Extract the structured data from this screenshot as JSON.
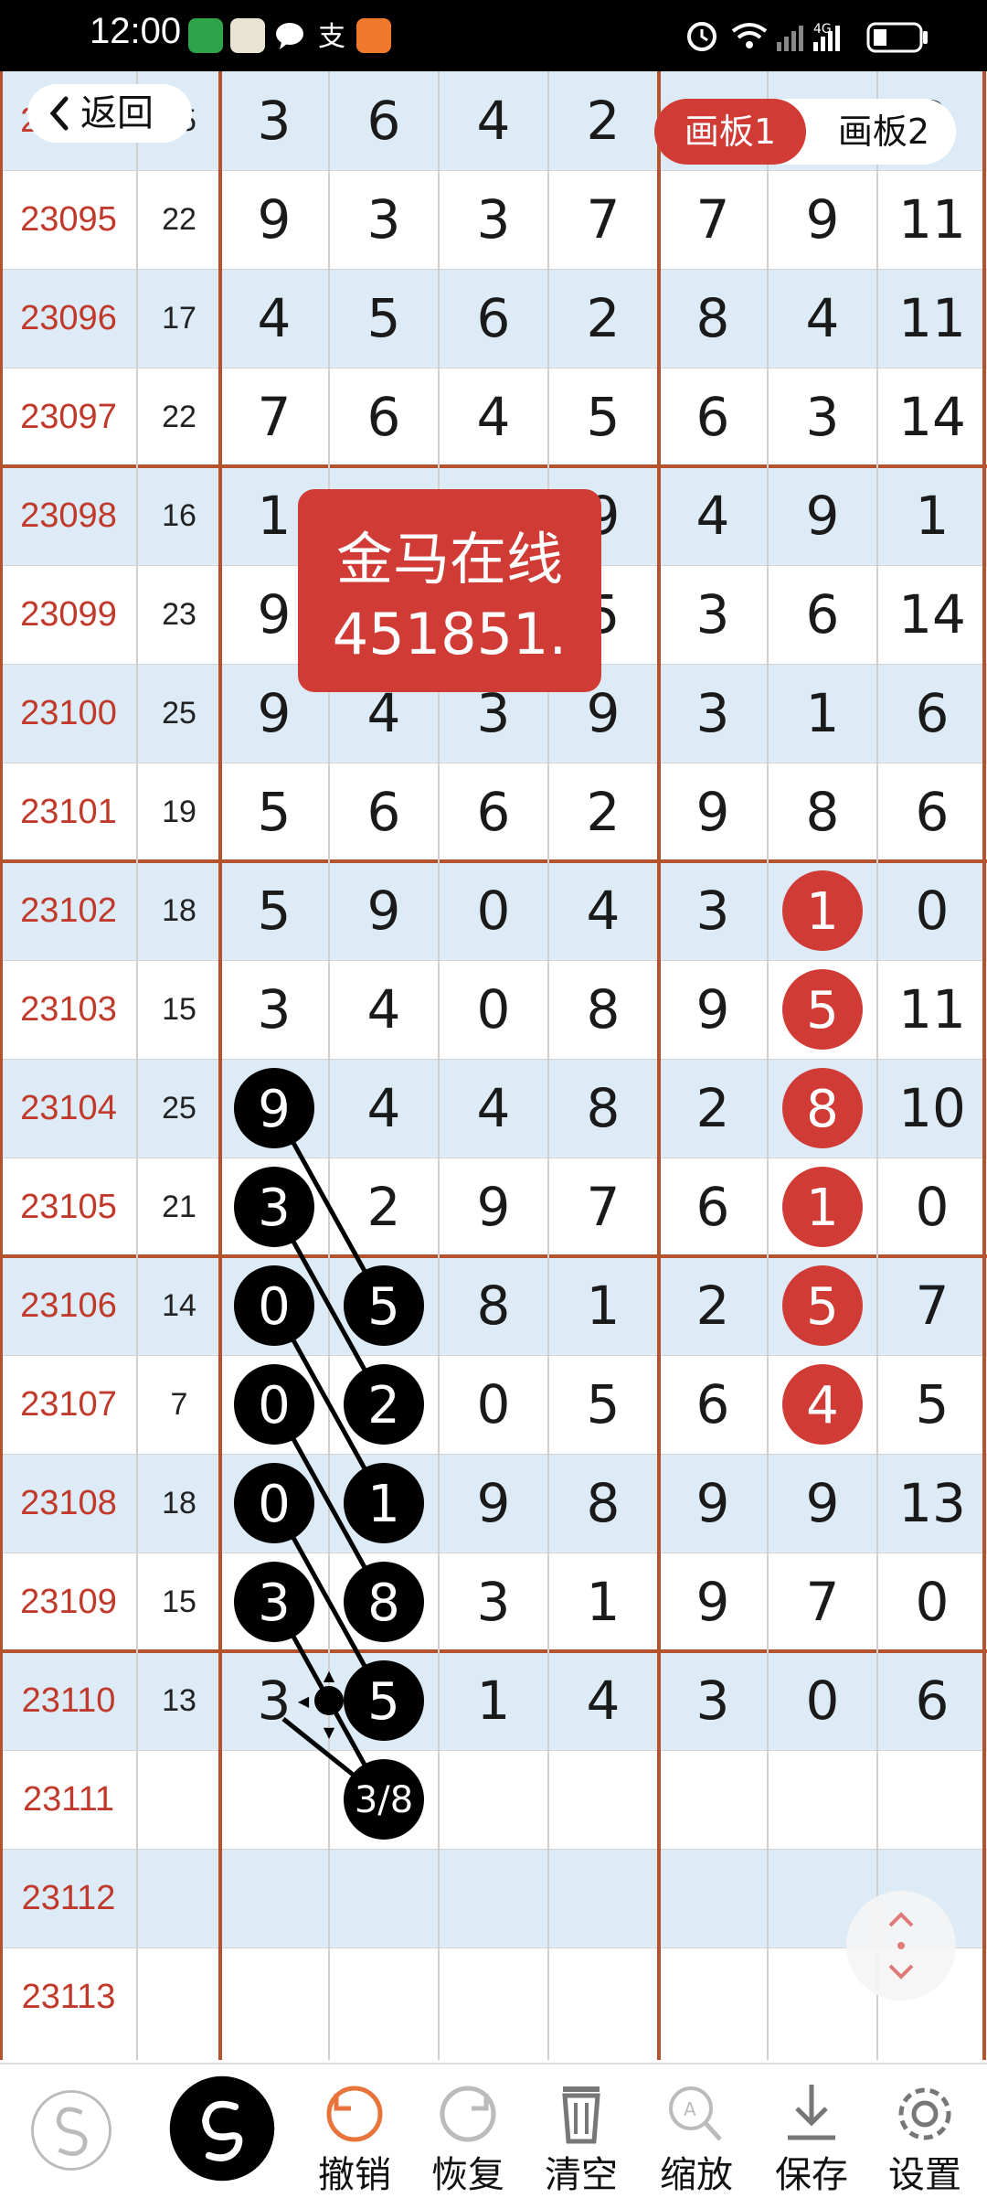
{
  "status": {
    "time": "12:00",
    "battery_icon": "battery-icon",
    "wifi_icon": "wifi-icon",
    "network": "4G",
    "signal_icon": "signal-icon",
    "alarm_icon": "alarm-icon"
  },
  "nav": {
    "back_label": "返回",
    "tabs": [
      {
        "label": "画板1",
        "active": true
      },
      {
        "label": "画板2",
        "active": false
      }
    ]
  },
  "watermark": {
    "line1": "金马在线",
    "line2": "451851."
  },
  "colors": {
    "accent_red": "#d03b36",
    "issue_text": "#c0392b",
    "row_blue": "#dcebf5",
    "grid_brown": "#b5532f"
  },
  "rows": [
    {
      "issue": "23094",
      "sum": "15",
      "digits": [
        "3",
        "6",
        "4",
        "2",
        "",
        "8",
        "2"
      ]
    },
    {
      "issue": "23095",
      "sum": "22",
      "digits": [
        "9",
        "3",
        "3",
        "7",
        "7",
        "9",
        "11"
      ]
    },
    {
      "issue": "23096",
      "sum": "17",
      "digits": [
        "4",
        "5",
        "6",
        "2",
        "8",
        "4",
        "11"
      ]
    },
    {
      "issue": "23097",
      "sum": "22",
      "digits": [
        "7",
        "6",
        "4",
        "5",
        "6",
        "3",
        "14"
      ]
    },
    {
      "issue": "23098",
      "sum": "16",
      "digits": [
        "1",
        "",
        "",
        "9",
        "4",
        "9",
        "1"
      ]
    },
    {
      "issue": "23099",
      "sum": "23",
      "digits": [
        "9",
        "",
        "",
        "5",
        "3",
        "6",
        "14"
      ]
    },
    {
      "issue": "23100",
      "sum": "25",
      "digits": [
        "9",
        "4",
        "3",
        "9",
        "3",
        "1",
        "6"
      ]
    },
    {
      "issue": "23101",
      "sum": "19",
      "digits": [
        "5",
        "6",
        "6",
        "2",
        "9",
        "8",
        "6"
      ]
    },
    {
      "issue": "23102",
      "sum": "18",
      "digits": [
        "5",
        "9",
        "0",
        "4",
        "3",
        "1",
        "0"
      ]
    },
    {
      "issue": "23103",
      "sum": "15",
      "digits": [
        "3",
        "4",
        "0",
        "8",
        "9",
        "5",
        "11"
      ]
    },
    {
      "issue": "23104",
      "sum": "25",
      "digits": [
        "9",
        "4",
        "4",
        "8",
        "2",
        "8",
        "10"
      ]
    },
    {
      "issue": "23105",
      "sum": "21",
      "digits": [
        "3",
        "2",
        "9",
        "7",
        "6",
        "1",
        "0"
      ]
    },
    {
      "issue": "23106",
      "sum": "14",
      "digits": [
        "0",
        "5",
        "8",
        "1",
        "2",
        "5",
        "7"
      ]
    },
    {
      "issue": "23107",
      "sum": "7",
      "digits": [
        "0",
        "2",
        "0",
        "5",
        "6",
        "4",
        "5"
      ]
    },
    {
      "issue": "23108",
      "sum": "18",
      "digits": [
        "0",
        "1",
        "9",
        "8",
        "9",
        "9",
        "13"
      ]
    },
    {
      "issue": "23109",
      "sum": "15",
      "digits": [
        "3",
        "8",
        "3",
        "1",
        "9",
        "7",
        "0"
      ]
    },
    {
      "issue": "23110",
      "sum": "13",
      "digits": [
        "3",
        "5",
        "1",
        "4",
        "3",
        "0",
        "6"
      ]
    },
    {
      "issue": "23111",
      "sum": "",
      "digits": [
        "",
        "3/8",
        "",
        "",
        "",
        "",
        ""
      ]
    },
    {
      "issue": "23112",
      "sum": "",
      "digits": [
        "",
        "",
        "",
        "",
        "",
        "",
        ""
      ]
    },
    {
      "issue": "23113",
      "sum": "",
      "digits": [
        "",
        "",
        "",
        "",
        "",
        "",
        ""
      ]
    }
  ],
  "red_marks": [
    {
      "row": 8,
      "col": 5,
      "value": "1"
    },
    {
      "row": 9,
      "col": 5,
      "value": "5"
    },
    {
      "row": 10,
      "col": 5,
      "value": "8"
    },
    {
      "row": 11,
      "col": 5,
      "value": "1"
    },
    {
      "row": 12,
      "col": 5,
      "value": "5"
    },
    {
      "row": 13,
      "col": 5,
      "value": "4"
    }
  ],
  "black_marks": [
    {
      "row": 10,
      "col": 0,
      "value": "9"
    },
    {
      "row": 11,
      "col": 0,
      "value": "3"
    },
    {
      "row": 12,
      "col": 0,
      "value": "0"
    },
    {
      "row": 13,
      "col": 0,
      "value": "0"
    },
    {
      "row": 14,
      "col": 0,
      "value": "0"
    },
    {
      "row": 15,
      "col": 0,
      "value": "3"
    },
    {
      "row": 12,
      "col": 1,
      "value": "5"
    },
    {
      "row": 13,
      "col": 1,
      "value": "2"
    },
    {
      "row": 14,
      "col": 1,
      "value": "1"
    },
    {
      "row": 15,
      "col": 1,
      "value": "8"
    },
    {
      "row": 16,
      "col": 1,
      "value": "5"
    },
    {
      "row": 17,
      "col": 1,
      "value": "3/8"
    }
  ],
  "toolbar": {
    "items": [
      {
        "label": "撤销",
        "icon": "undo-icon"
      },
      {
        "label": "恢复",
        "icon": "redo-icon"
      },
      {
        "label": "清空",
        "icon": "trash-icon"
      },
      {
        "label": "缩放",
        "icon": "zoom-icon"
      },
      {
        "label": "保存",
        "icon": "download-icon"
      },
      {
        "label": "设置",
        "icon": "gear-icon"
      }
    ]
  }
}
